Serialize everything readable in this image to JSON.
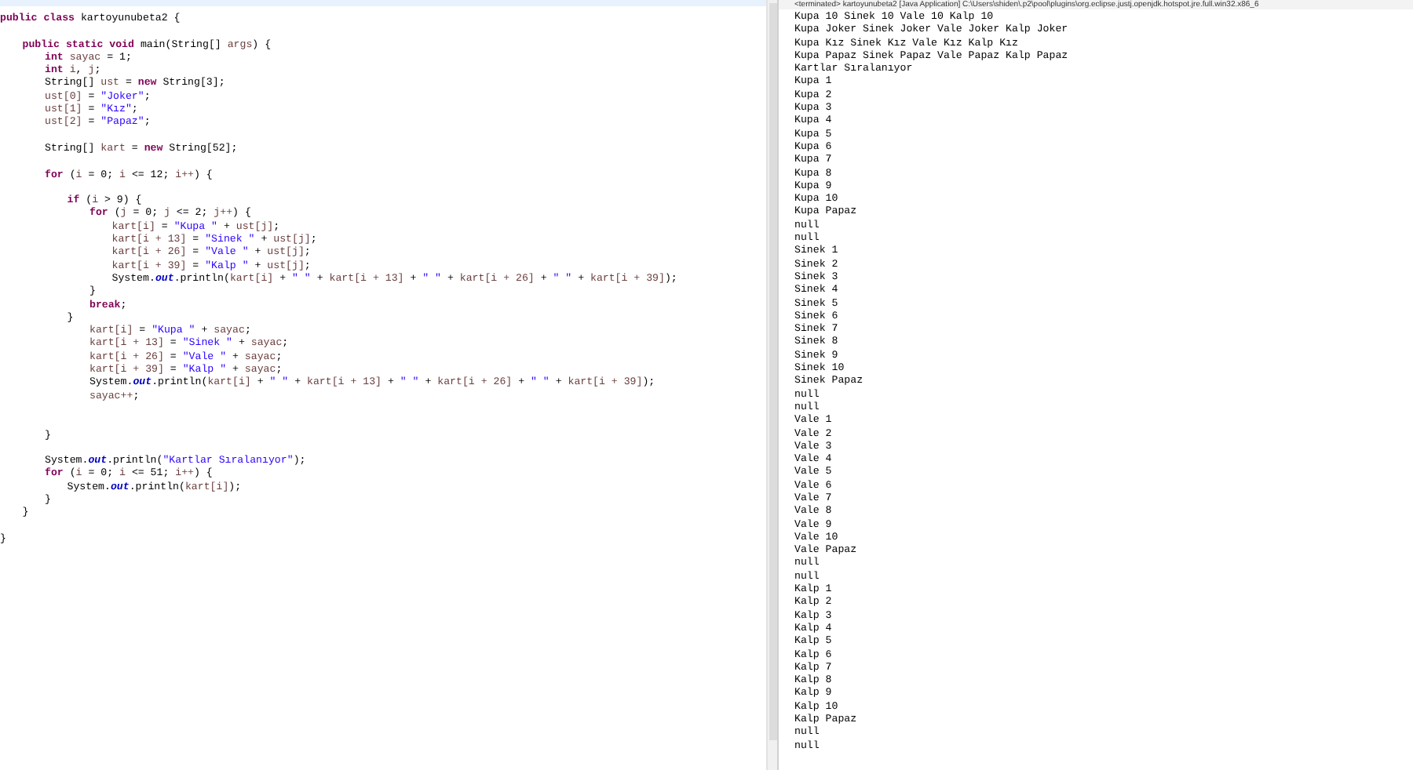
{
  "editor": {
    "lines": [
      {
        "tokens": [
          {
            "kind": "k",
            "text": "public class"
          },
          {
            "kind": "p",
            "text": " kartoyunubeta2 {"
          }
        ]
      },
      {
        "blank_before": true,
        "tokens": [
          {
            "kind": "k",
            "text": "\tpublic static void"
          },
          {
            "kind": "p",
            "text": " main(String[] "
          },
          {
            "kind": "v",
            "text": "args"
          },
          {
            "kind": "p",
            "text": ") {"
          }
        ]
      },
      {
        "tokens": [
          {
            "kind": "k",
            "text": "\t\tint"
          },
          {
            "kind": "v",
            "text": " sayac"
          },
          {
            "kind": "p",
            "text": " = 1;"
          }
        ]
      },
      {
        "tokens": [
          {
            "kind": "k",
            "text": "\t\tint"
          },
          {
            "kind": "v",
            "text": " i"
          },
          {
            "kind": "p",
            "text": ", "
          },
          {
            "kind": "v",
            "text": "j"
          },
          {
            "kind": "p",
            "text": ";"
          }
        ]
      },
      {
        "tokens": [
          {
            "kind": "p",
            "text": "\t\tString[] "
          },
          {
            "kind": "v",
            "text": "ust"
          },
          {
            "kind": "p",
            "text": " = "
          },
          {
            "kind": "k",
            "text": "new"
          },
          {
            "kind": "p",
            "text": " String[3];"
          }
        ]
      },
      {
        "tokens": [
          {
            "kind": "v",
            "text": "\t\tust[0]"
          },
          {
            "kind": "p",
            "text": " = "
          },
          {
            "kind": "s",
            "text": "\"Joker\""
          },
          {
            "kind": "p",
            "text": ";"
          }
        ]
      },
      {
        "tokens": [
          {
            "kind": "v",
            "text": "\t\tust[1]"
          },
          {
            "kind": "p",
            "text": " = "
          },
          {
            "kind": "s",
            "text": "\"Kız\""
          },
          {
            "kind": "p",
            "text": ";"
          }
        ]
      },
      {
        "tokens": [
          {
            "kind": "v",
            "text": "\t\tust[2]"
          },
          {
            "kind": "p",
            "text": " = "
          },
          {
            "kind": "s",
            "text": "\"Papaz\""
          },
          {
            "kind": "p",
            "text": ";"
          }
        ]
      },
      {
        "blank_before": true,
        "tokens": [
          {
            "kind": "p",
            "text": "\t\tString[] "
          },
          {
            "kind": "v",
            "text": "kart"
          },
          {
            "kind": "p",
            "text": " = "
          },
          {
            "kind": "k",
            "text": "new"
          },
          {
            "kind": "p",
            "text": " String[52];"
          }
        ]
      },
      {
        "blank_before": true,
        "tokens": [
          {
            "kind": "k",
            "text": "\t\tfor"
          },
          {
            "kind": "p",
            "text": " ("
          },
          {
            "kind": "v",
            "text": "i"
          },
          {
            "kind": "p",
            "text": " = 0; "
          },
          {
            "kind": "v",
            "text": "i"
          },
          {
            "kind": "p",
            "text": " <= 12; "
          },
          {
            "kind": "v",
            "text": "i++"
          },
          {
            "kind": "p",
            "text": ") {"
          }
        ]
      },
      {
        "blank_before": true,
        "tokens": [
          {
            "kind": "k",
            "text": "\t\t\tif"
          },
          {
            "kind": "p",
            "text": " ("
          },
          {
            "kind": "v",
            "text": "i"
          },
          {
            "kind": "p",
            "text": " > 9) {"
          }
        ]
      },
      {
        "tokens": [
          {
            "kind": "k",
            "text": "\t\t\t\tfor"
          },
          {
            "kind": "p",
            "text": " ("
          },
          {
            "kind": "v",
            "text": "j"
          },
          {
            "kind": "p",
            "text": " = 0; "
          },
          {
            "kind": "v",
            "text": "j"
          },
          {
            "kind": "p",
            "text": " <= 2; "
          },
          {
            "kind": "v",
            "text": "j++"
          },
          {
            "kind": "p",
            "text": ") {"
          }
        ]
      },
      {
        "tokens": [
          {
            "kind": "v",
            "text": "\t\t\t\t\tkart[i]"
          },
          {
            "kind": "p",
            "text": " = "
          },
          {
            "kind": "s",
            "text": "\"Kupa \""
          },
          {
            "kind": "p",
            "text": " + "
          },
          {
            "kind": "v",
            "text": "ust[j]"
          },
          {
            "kind": "p",
            "text": ";"
          }
        ]
      },
      {
        "tokens": [
          {
            "kind": "v",
            "text": "\t\t\t\t\tkart[i + 13]"
          },
          {
            "kind": "p",
            "text": " = "
          },
          {
            "kind": "s",
            "text": "\"Sinek \""
          },
          {
            "kind": "p",
            "text": " + "
          },
          {
            "kind": "v",
            "text": "ust[j]"
          },
          {
            "kind": "p",
            "text": ";"
          }
        ]
      },
      {
        "tokens": [
          {
            "kind": "v",
            "text": "\t\t\t\t\tkart[i + 26]"
          },
          {
            "kind": "p",
            "text": " = "
          },
          {
            "kind": "s",
            "text": "\"Vale \""
          },
          {
            "kind": "p",
            "text": " + "
          },
          {
            "kind": "v",
            "text": "ust[j]"
          },
          {
            "kind": "p",
            "text": ";"
          }
        ]
      },
      {
        "tokens": [
          {
            "kind": "v",
            "text": "\t\t\t\t\tkart[i + 39]"
          },
          {
            "kind": "p",
            "text": " = "
          },
          {
            "kind": "s",
            "text": "\"Kalp \""
          },
          {
            "kind": "p",
            "text": " + "
          },
          {
            "kind": "v",
            "text": "ust[j]"
          },
          {
            "kind": "p",
            "text": ";"
          }
        ]
      },
      {
        "tokens": [
          {
            "kind": "p",
            "text": "\t\t\t\t\tSystem."
          },
          {
            "kind": "f",
            "text": "out"
          },
          {
            "kind": "p",
            "text": ".println("
          },
          {
            "kind": "v",
            "text": "kart[i]"
          },
          {
            "kind": "p",
            "text": " + "
          },
          {
            "kind": "s",
            "text": "\" \""
          },
          {
            "kind": "p",
            "text": " + "
          },
          {
            "kind": "v",
            "text": "kart[i + 13]"
          },
          {
            "kind": "p",
            "text": " + "
          },
          {
            "kind": "s",
            "text": "\" \""
          },
          {
            "kind": "p",
            "text": " + "
          },
          {
            "kind": "v",
            "text": "kart[i + 26]"
          },
          {
            "kind": "p",
            "text": " + "
          },
          {
            "kind": "s",
            "text": "\" \""
          },
          {
            "kind": "p",
            "text": " + "
          },
          {
            "kind": "v",
            "text": "kart[i + 39]"
          },
          {
            "kind": "p",
            "text": ");"
          }
        ]
      },
      {
        "tokens": [
          {
            "kind": "p",
            "text": "\t\t\t\t}"
          }
        ]
      },
      {
        "tokens": [
          {
            "kind": "k",
            "text": "\t\t\t\tbreak"
          },
          {
            "kind": "p",
            "text": ";"
          }
        ]
      },
      {
        "tokens": [
          {
            "kind": "p",
            "text": "\t\t\t}"
          }
        ]
      },
      {
        "tokens": [
          {
            "kind": "v",
            "text": "\t\t\t\tkart[i]"
          },
          {
            "kind": "p",
            "text": " = "
          },
          {
            "kind": "s",
            "text": "\"Kupa \""
          },
          {
            "kind": "p",
            "text": " + "
          },
          {
            "kind": "v",
            "text": "sayac"
          },
          {
            "kind": "p",
            "text": ";"
          }
        ]
      },
      {
        "tokens": [
          {
            "kind": "v",
            "text": "\t\t\t\tkart[i + 13]"
          },
          {
            "kind": "p",
            "text": " = "
          },
          {
            "kind": "s",
            "text": "\"Sinek \""
          },
          {
            "kind": "p",
            "text": " + "
          },
          {
            "kind": "v",
            "text": "sayac"
          },
          {
            "kind": "p",
            "text": ";"
          }
        ]
      },
      {
        "tokens": [
          {
            "kind": "v",
            "text": "\t\t\t\tkart[i + 26]"
          },
          {
            "kind": "p",
            "text": " = "
          },
          {
            "kind": "s",
            "text": "\"Vale \""
          },
          {
            "kind": "p",
            "text": " + "
          },
          {
            "kind": "v",
            "text": "sayac"
          },
          {
            "kind": "p",
            "text": ";"
          }
        ]
      },
      {
        "tokens": [
          {
            "kind": "v",
            "text": "\t\t\t\tkart[i + 39]"
          },
          {
            "kind": "p",
            "text": " = "
          },
          {
            "kind": "s",
            "text": "\"Kalp \""
          },
          {
            "kind": "p",
            "text": " + "
          },
          {
            "kind": "v",
            "text": "sayac"
          },
          {
            "kind": "p",
            "text": ";"
          }
        ]
      },
      {
        "tokens": [
          {
            "kind": "p",
            "text": "\t\t\t\tSystem."
          },
          {
            "kind": "f",
            "text": "out"
          },
          {
            "kind": "p",
            "text": ".println("
          },
          {
            "kind": "v",
            "text": "kart[i]"
          },
          {
            "kind": "p",
            "text": " + "
          },
          {
            "kind": "s",
            "text": "\" \""
          },
          {
            "kind": "p",
            "text": " + "
          },
          {
            "kind": "v",
            "text": "kart[i + 13]"
          },
          {
            "kind": "p",
            "text": " + "
          },
          {
            "kind": "s",
            "text": "\" \""
          },
          {
            "kind": "p",
            "text": " + "
          },
          {
            "kind": "v",
            "text": "kart[i + 26]"
          },
          {
            "kind": "p",
            "text": " + "
          },
          {
            "kind": "s",
            "text": "\" \""
          },
          {
            "kind": "p",
            "text": " + "
          },
          {
            "kind": "v",
            "text": "kart[i + 39]"
          },
          {
            "kind": "p",
            "text": ");"
          }
        ]
      },
      {
        "tokens": [
          {
            "kind": "v",
            "text": "\t\t\t\tsayac++"
          },
          {
            "kind": "p",
            "text": ";"
          }
        ]
      },
      {
        "blank_before": true,
        "wide_gap": true,
        "tokens": [
          {
            "kind": "p",
            "text": "\t\t}"
          }
        ]
      },
      {
        "blank_before": true,
        "tokens": [
          {
            "kind": "p",
            "text": "\t\tSystem."
          },
          {
            "kind": "f",
            "text": "out"
          },
          {
            "kind": "p",
            "text": ".println("
          },
          {
            "kind": "s",
            "text": "\"Kartlar Sıralanıyor\""
          },
          {
            "kind": "p",
            "text": ");"
          }
        ]
      },
      {
        "tokens": [
          {
            "kind": "k",
            "text": "\t\tfor"
          },
          {
            "kind": "p",
            "text": " ("
          },
          {
            "kind": "v",
            "text": "i"
          },
          {
            "kind": "p",
            "text": " = 0; "
          },
          {
            "kind": "v",
            "text": "i"
          },
          {
            "kind": "p",
            "text": " <= 51; "
          },
          {
            "kind": "v",
            "text": "i++"
          },
          {
            "kind": "p",
            "text": ") {"
          }
        ]
      },
      {
        "tokens": [
          {
            "kind": "p",
            "text": "\t\t\tSystem."
          },
          {
            "kind": "f",
            "text": "out"
          },
          {
            "kind": "p",
            "text": ".println("
          },
          {
            "kind": "v",
            "text": "kart[i]"
          },
          {
            "kind": "p",
            "text": ");"
          }
        ]
      },
      {
        "tokens": [
          {
            "kind": "p",
            "text": "\t\t}"
          }
        ]
      },
      {
        "tokens": [
          {
            "kind": "p",
            "text": "\t}"
          }
        ]
      },
      {
        "blank_before": true,
        "tokens": [
          {
            "kind": "p",
            "text": "}"
          }
        ]
      }
    ]
  },
  "console": {
    "header": "<terminated> kartoyunubeta2 [Java Application] C:\\Users\\shiden\\.p2\\pool\\plugins\\org.eclipse.justj.openjdk.hotspot.jre.full.win32.x86_6",
    "lines": [
      "Kupa 10 Sinek 10 Vale 10 Kalp 10",
      "Kupa Joker Sinek Joker Vale Joker Kalp Joker",
      "Kupa Kız Sinek Kız Vale Kız Kalp Kız",
      "Kupa Papaz Sinek Papaz Vale Papaz Kalp Papaz",
      "Kartlar Sıralanıyor",
      "Kupa 1",
      "Kupa 2",
      "Kupa 3",
      "Kupa 4",
      "Kupa 5",
      "Kupa 6",
      "Kupa 7",
      "Kupa 8",
      "Kupa 9",
      "Kupa 10",
      "Kupa Papaz",
      "null",
      "null",
      "Sinek 1",
      "Sinek 2",
      "Sinek 3",
      "Sinek 4",
      "Sinek 5",
      "Sinek 6",
      "Sinek 7",
      "Sinek 8",
      "Sinek 9",
      "Sinek 10",
      "Sinek Papaz",
      "null",
      "null",
      "Vale 1",
      "Vale 2",
      "Vale 3",
      "Vale 4",
      "Vale 5",
      "Vale 6",
      "Vale 7",
      "Vale 8",
      "Vale 9",
      "Vale 10",
      "Vale Papaz",
      "null",
      "null",
      "Kalp 1",
      "Kalp 2",
      "Kalp 3",
      "Kalp 4",
      "Kalp 5",
      "Kalp 6",
      "Kalp 7",
      "Kalp 8",
      "Kalp 9",
      "Kalp 10",
      "Kalp Papaz",
      "null",
      "null"
    ]
  }
}
